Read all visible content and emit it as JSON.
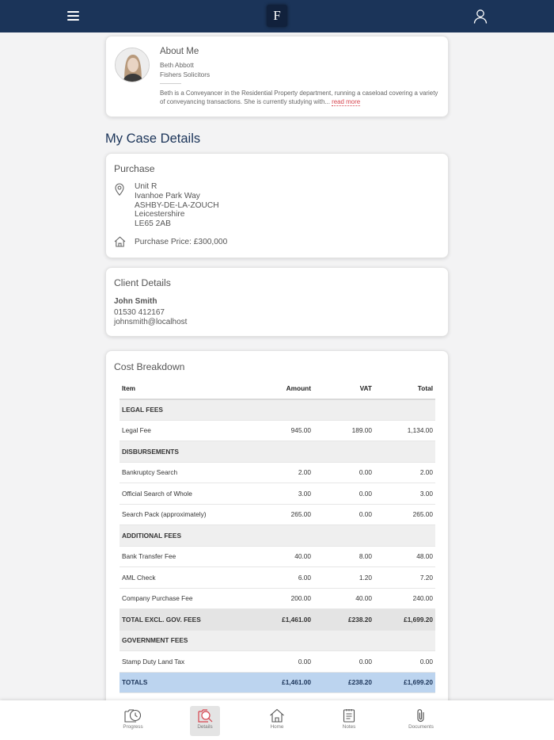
{
  "header": {
    "logo_text": "F",
    "hamburger_icon": "menu-icon",
    "user_icon": "user-icon"
  },
  "about": {
    "title": "About Me",
    "name": "Beth Abbott",
    "firm": "Fishers Solicitors",
    "bio": "Beth is a Conveyancer in the Residential Property department, running a caseload covering a variety of conveyancing transactions. She is currently studying with...",
    "read_more": "read more"
  },
  "case_details_title": "My Case Details",
  "purchase": {
    "title": "Purchase",
    "address": [
      "Unit R",
      "Ivanhoe Park Way",
      "ASHBY-DE-LA-ZOUCH",
      "Leicestershire",
      "LE65 2AB"
    ],
    "price": "Purchase Price: £300,000"
  },
  "client": {
    "title": "Client Details",
    "name": "John Smith",
    "phone": "01530 412167",
    "email": "johnsmith@localhost"
  },
  "cost": {
    "title": "Cost Breakdown",
    "columns": [
      "Item",
      "Amount",
      "VAT",
      "Total"
    ],
    "rows": [
      {
        "type": "section",
        "item": "LEGAL FEES"
      },
      {
        "type": "item",
        "item": "Legal Fee",
        "amount": "945.00",
        "vat": "189.00",
        "total": "1,134.00"
      },
      {
        "type": "section",
        "item": "DISBURSEMENTS"
      },
      {
        "type": "item",
        "item": "Bankruptcy Search",
        "amount": "2.00",
        "vat": "0.00",
        "total": "2.00"
      },
      {
        "type": "item",
        "item": "Official Search of Whole",
        "amount": "3.00",
        "vat": "0.00",
        "total": "3.00"
      },
      {
        "type": "item",
        "item": "Search Pack (approximately)",
        "amount": "265.00",
        "vat": "0.00",
        "total": "265.00"
      },
      {
        "type": "section",
        "item": "ADDITIONAL FEES"
      },
      {
        "type": "item",
        "item": "Bank Transfer Fee",
        "amount": "40.00",
        "vat": "8.00",
        "total": "48.00"
      },
      {
        "type": "item",
        "item": "AML Check",
        "amount": "6.00",
        "vat": "1.20",
        "total": "7.20"
      },
      {
        "type": "item",
        "item": "Company Purchase Fee",
        "amount": "200.00",
        "vat": "40.00",
        "total": "240.00"
      },
      {
        "type": "subtotal",
        "item": "TOTAL EXCL. GOV. FEES",
        "amount": "£1,461.00",
        "vat": "£238.20",
        "total": "£1,699.20"
      },
      {
        "type": "section",
        "item": "GOVERNMENT FEES"
      },
      {
        "type": "item",
        "item": "Stamp Duty Land Tax",
        "amount": "0.00",
        "vat": "0.00",
        "total": "0.00"
      },
      {
        "type": "totals",
        "item": "TOTALS",
        "amount": "£1,461.00",
        "vat": "£238.20",
        "total": "£1,699.20"
      }
    ]
  },
  "nav": [
    {
      "label": "Progress",
      "icon": "progress-icon",
      "active": false
    },
    {
      "label": "Details",
      "icon": "details-icon",
      "active": true
    },
    {
      "label": "Home",
      "icon": "home-icon",
      "active": false
    },
    {
      "label": "Notes",
      "icon": "notes-icon",
      "active": false
    },
    {
      "label": "Documents",
      "icon": "documents-icon",
      "active": false
    }
  ],
  "colors": {
    "navy": "#1b3459",
    "accent": "#d6454f",
    "totals_row": "#bcd4ef"
  }
}
